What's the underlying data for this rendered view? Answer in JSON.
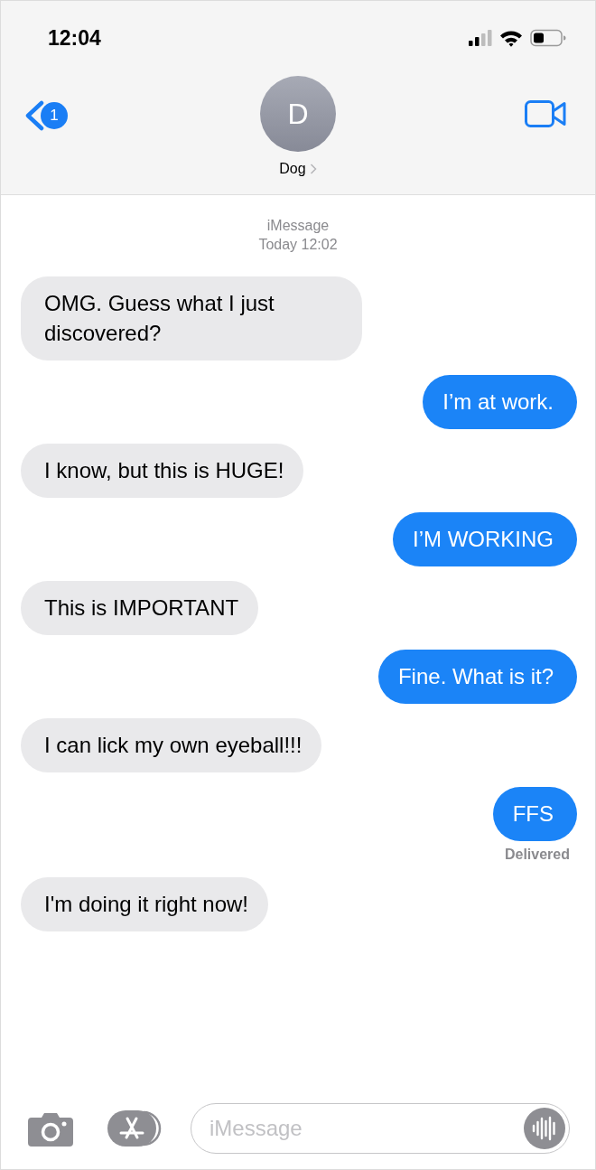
{
  "status_bar": {
    "time": "12:04"
  },
  "header": {
    "back_badge": "1",
    "avatar_initial": "D",
    "contact_name": "Dog"
  },
  "conversation": {
    "service": "iMessage",
    "timestamp": "Today 12:02",
    "messages": [
      {
        "kind": "received",
        "text": "OMG. Guess what I just discovered?"
      },
      {
        "kind": "sent",
        "text": "I’m at work."
      },
      {
        "kind": "received",
        "text": "I know, but this is HUGE!"
      },
      {
        "kind": "sent",
        "text": "I’M WORKING"
      },
      {
        "kind": "received",
        "text": "This is IMPORTANT"
      },
      {
        "kind": "sent",
        "text": "Fine. What is it?"
      },
      {
        "kind": "received",
        "text": "I can lick my own eyeball!!!"
      },
      {
        "kind": "sent",
        "text": "FFS",
        "status": "Delivered"
      },
      {
        "kind": "received",
        "text": "I'm doing it right now!"
      }
    ]
  },
  "composer": {
    "placeholder": "iMessage"
  }
}
